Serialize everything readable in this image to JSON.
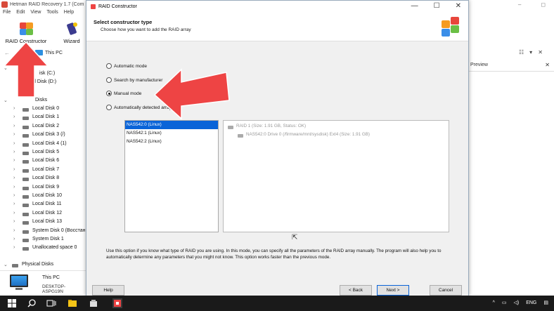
{
  "app": {
    "title": "Hetman RAID Recovery 1.7 (Com",
    "window_controls": [
      "–",
      "◻"
    ],
    "menu": [
      "File",
      "Edit",
      "View",
      "Tools",
      "Help"
    ],
    "toolbar": {
      "raid_constructor_label": "RAID Constructor",
      "wizard_label": "Wizard"
    },
    "address": {
      "back": "←",
      "forward": "→",
      "up": "↑",
      "path": "This PC"
    },
    "preview_label": "Preview",
    "preview_close": "✕",
    "view_tools": [
      "☷",
      "▾",
      "✕"
    ],
    "tree_group_top": {
      "chev": "⌄"
    },
    "tree_partials": [
      "isk (C:)",
      "cal Disk (D:)"
    ],
    "hard_disks_label": "Disks",
    "disks": [
      "Local Disk 0",
      "Local Disk 1",
      "Local Disk 2",
      "Local Disk 3 (/)",
      "Local Disk 4 (1)",
      "Local Disk 5",
      "Local Disk 6",
      "Local Disk 7",
      "Local Disk 8",
      "Local Disk 9",
      "Local Disk 10",
      "Local Disk 11",
      "Local Disk 12",
      "Local Disk 13",
      "System Disk 0 (Восстан",
      "System Disk 1",
      "Unallocated space 0"
    ],
    "physical_disks_label": "Physical Disks",
    "computer": {
      "name": "This PC",
      "host": "DESKTOP-ASPG19N"
    }
  },
  "dialog": {
    "title": "RAID Constructor",
    "controls": [
      "—",
      "☐",
      "✕"
    ],
    "header_title": "Select constructor type",
    "header_subtitle": "Choose how you want to add the RAID array",
    "modes": [
      {
        "label": "Automatic mode",
        "checked": false
      },
      {
        "label": "Search by manufacturer",
        "checked": false
      },
      {
        "label": "Manual mode",
        "checked": true
      },
      {
        "label": "Automatically detected arrays",
        "checked": false
      }
    ],
    "detected_arrays": [
      "NAS542:0 (Linux)",
      "NAS542:1 (Linux)",
      "NAS542:2 (Linux)"
    ],
    "selected_index": 0,
    "details": {
      "raid": "RAID 1 (Size: 1.91 GB, Status: OK)",
      "drive": "NAS542:0 Drive 0 (/firmware/mnt/sysdisk) Ext4 (Size: 1.91 GB)"
    },
    "description": "Use this option if you know what type of RAID you are using. In this mode, you can specify all the parameters of the RAID array manually. The program will also help you to automatically determine any parameters that you might not know. This option works faster than the previous mode.",
    "buttons": {
      "help": "Help",
      "back": "< Back",
      "next": "Next >",
      "cancel": "Cancel"
    }
  },
  "taskbar": {
    "tray_chevron": "^",
    "language": "ENG",
    "notifications": "▤"
  },
  "colors": {
    "accent": "#0a64d8",
    "arrow": "#ee4444"
  }
}
